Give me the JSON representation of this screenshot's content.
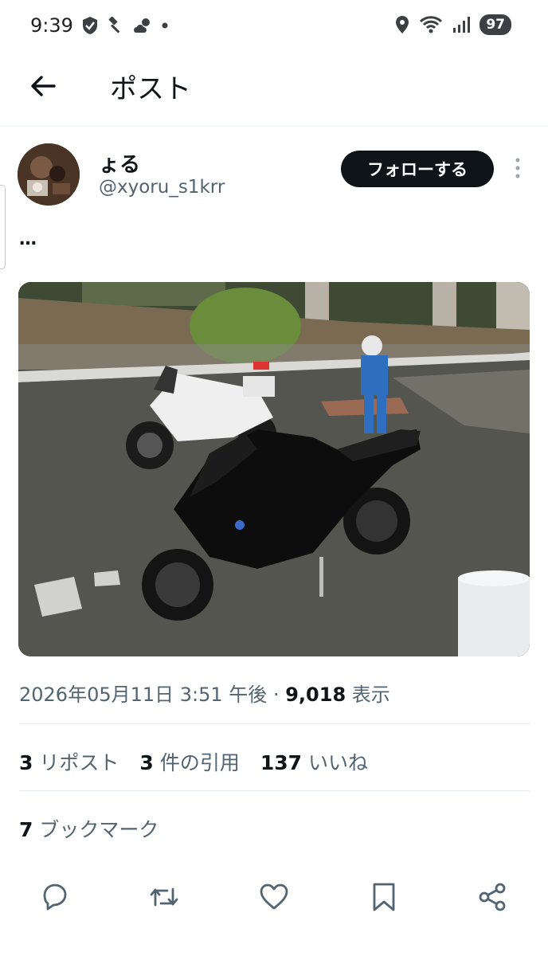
{
  "status_bar": {
    "time": "9:39",
    "battery": "97",
    "icons_left": [
      "shield-icon",
      "hammer-icon",
      "cloud-sun-icon",
      "dot-icon"
    ],
    "icons_right": [
      "location-icon",
      "wifi-icon",
      "signal-icon",
      "battery-icon"
    ]
  },
  "header": {
    "title": "ポスト",
    "back_icon": "arrow-left-icon"
  },
  "post": {
    "display_name": "ょる",
    "handle": "@xyoru_s1krr",
    "follow_label": "フォローする",
    "text": "…",
    "media_description_icon": "motorcycle-photo",
    "meta": {
      "date": "2026年05月11日 3:51 午後",
      "separator": "·",
      "views_count": "9,018",
      "views_label": "表示"
    },
    "stats": {
      "reposts_count": "3",
      "reposts_label": "リポスト",
      "quotes_count": "3",
      "quotes_label": "件の引用",
      "likes_count": "137",
      "likes_label": "いいね"
    },
    "bookmarks": {
      "count": "7",
      "label": "ブックマーク"
    },
    "actions": [
      "reply-icon",
      "repost-icon",
      "like-icon",
      "bookmark-icon",
      "share-icon"
    ]
  }
}
